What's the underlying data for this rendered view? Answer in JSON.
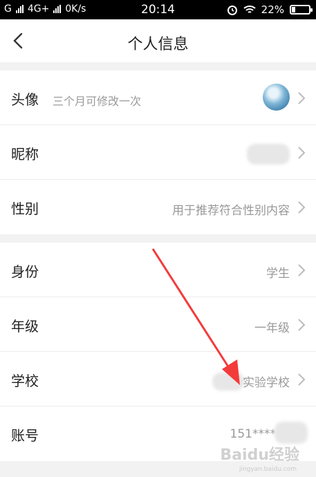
{
  "status_bar": {
    "carrier_left": "G",
    "network": "4G+",
    "speed": "0K/s",
    "time": "20:14",
    "battery": "22%",
    "battery_level": 0.22
  },
  "nav": {
    "title": "个人信息"
  },
  "profile_rows": [
    {
      "label": "头像",
      "hint": "三个月可修改一次",
      "value": ""
    },
    {
      "label": "昵称",
      "value": ""
    },
    {
      "label": "性别",
      "value": "用于推荐符合性别内容"
    }
  ],
  "account_rows": [
    {
      "label": "身份",
      "value": "学生"
    },
    {
      "label": "年级",
      "value": "一年级"
    },
    {
      "label": "学校",
      "value": "实验学校"
    },
    {
      "label": "账号",
      "value": "151****"
    }
  ],
  "watermark": {
    "text": "Baidu经验",
    "sub": "jingyan.baidu.com"
  },
  "colors": {
    "annotation_arrow": "#f33b3b",
    "status_bar": "#000000"
  }
}
